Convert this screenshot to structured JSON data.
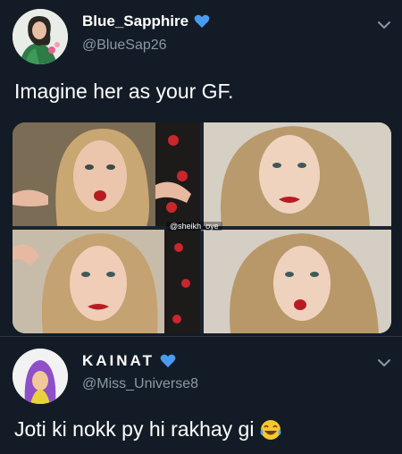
{
  "tweets": [
    {
      "display_name": "Blue_Sapphire",
      "handle": "@BlueSap26",
      "verified_icon": "blue-heart-icon",
      "text": "Imagine her as your GF.",
      "media_watermark": "@sheikh_oye"
    },
    {
      "display_name": "KAINAT",
      "handle": "@Miss_Universe8",
      "verified_icon": "blue-heart-icon",
      "text": "Joti ki nokk py hi rakhay gi",
      "emoji": "tears-of-joy-emoji"
    }
  ],
  "colors": {
    "background": "#131c26",
    "text": "#ffffff",
    "muted": "#8a98a6",
    "heart": "#4a9bf0",
    "lips": "#b71c22"
  }
}
